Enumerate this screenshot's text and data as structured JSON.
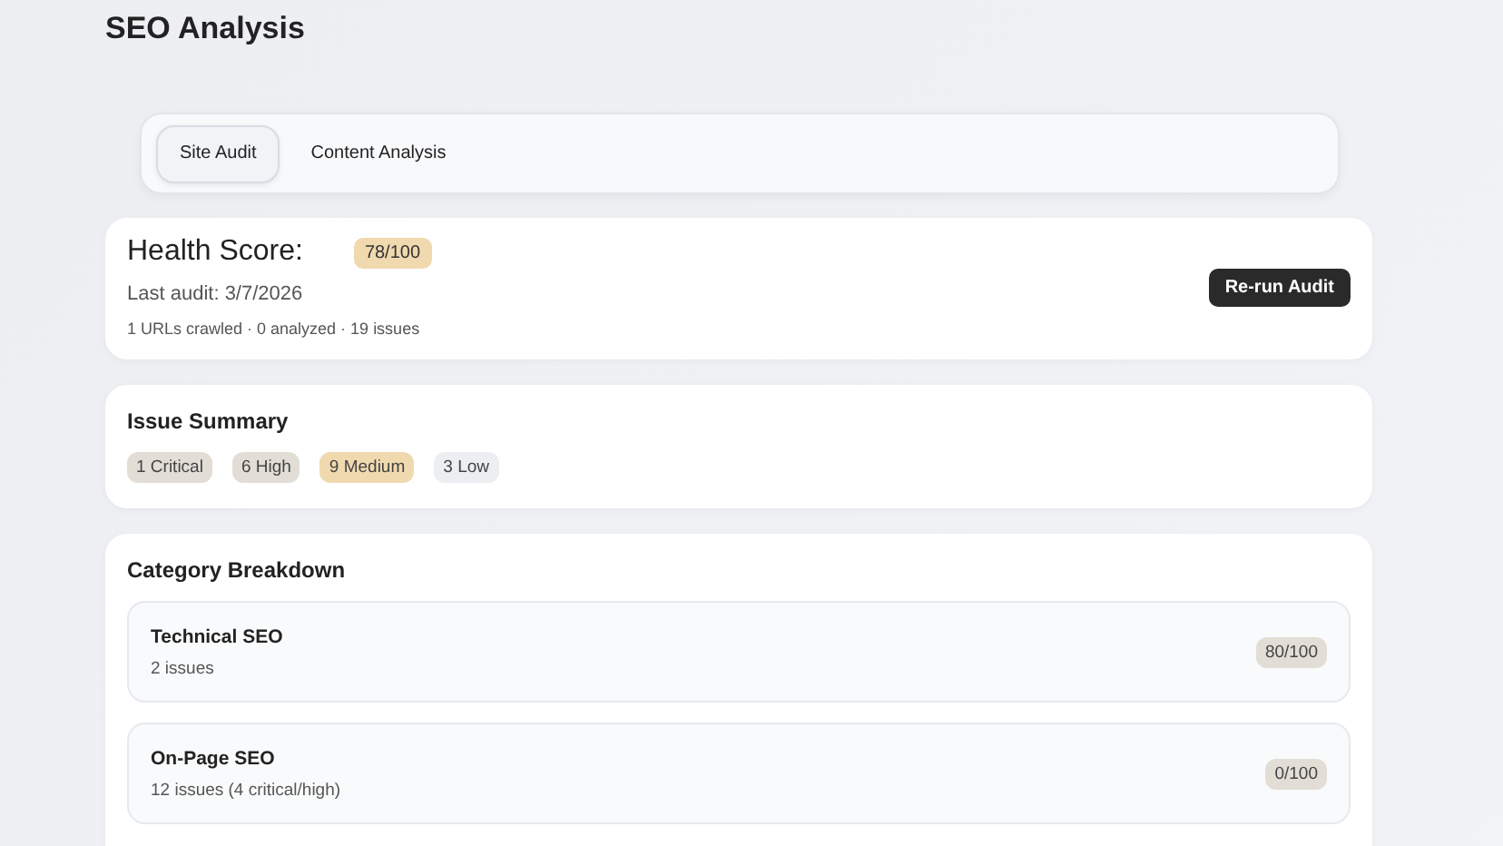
{
  "page_title": "SEO Analysis",
  "tabs": [
    {
      "label": "Site Audit",
      "selected": true
    },
    {
      "label": "Content Analysis",
      "selected": false
    }
  ],
  "health": {
    "title": "Health Score:",
    "score": "78/100",
    "last_audit": "Last audit: 3/7/2026",
    "stats": "1 URLs crawled · 0 analyzed · 19 issues",
    "button": "Re-run Audit"
  },
  "issue_summary": {
    "title": "Issue Summary",
    "badges": [
      {
        "label": "1 Critical",
        "color": "#e2ded6"
      },
      {
        "label": "6 High",
        "color": "#e2ded6"
      },
      {
        "label": "9 Medium",
        "color": "#f0d9ae"
      },
      {
        "label": "3 Low",
        "color": "#eceef1"
      }
    ]
  },
  "category_breakdown": {
    "title": "Category Breakdown",
    "categories": [
      {
        "name": "Technical SEO",
        "issues": "2 issues",
        "score": "80/100"
      },
      {
        "name": "On-Page SEO",
        "issues": "12 issues (4 critical/high)",
        "score": "0/100"
      }
    ]
  }
}
